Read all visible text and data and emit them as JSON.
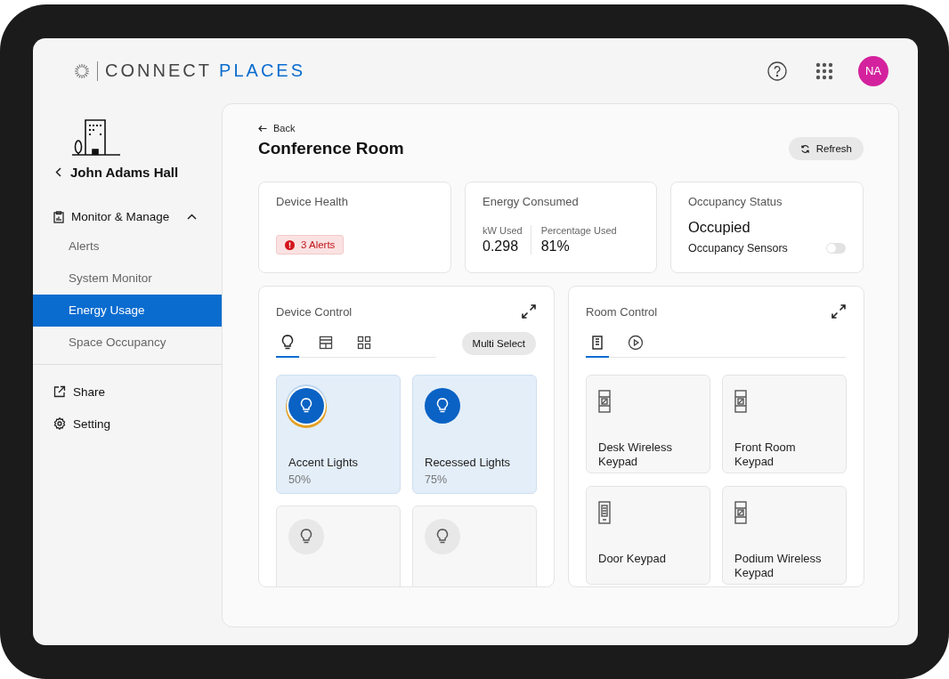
{
  "header": {
    "logo_text": "CONNECT",
    "logo_accent": "PLACES",
    "avatar_initials": "NA"
  },
  "sidebar": {
    "building": "John Adams Hall",
    "section": {
      "label": "Monitor & Manage",
      "expanded": true,
      "items": [
        {
          "label": "Alerts",
          "selected": false
        },
        {
          "label": "System Monitor",
          "selected": false
        },
        {
          "label": "Energy Usage",
          "selected": true
        },
        {
          "label": "Space Occupancy",
          "selected": false
        }
      ]
    },
    "links": [
      {
        "kind": "share",
        "label": "Share"
      },
      {
        "kind": "setting",
        "label": "Setting"
      }
    ]
  },
  "main": {
    "back": "Back",
    "title": "Conference Room",
    "refresh": "Refresh",
    "device_health": {
      "title": "Device Health",
      "alerts": "3 Alerts"
    },
    "energy": {
      "title": "Energy Consumed",
      "metrics": [
        {
          "label": "kW Used",
          "value": "0.298"
        },
        {
          "label": "Percentage Used",
          "value": "81%"
        }
      ]
    },
    "occupancy": {
      "title": "Occupancy Status",
      "status": "Occupied",
      "sensor_label": "Occupancy Sensors",
      "sensors_on": false
    },
    "device_control": {
      "title": "Device Control",
      "multi_select": "Multi Select",
      "tabs": [
        {
          "kind": "bulb",
          "selected": true
        },
        {
          "kind": "shade",
          "selected": false
        },
        {
          "kind": "grid",
          "selected": false
        }
      ],
      "devices": [
        {
          "name": "Accent Lights",
          "reading": "50%",
          "on": true,
          "highlighted": true
        },
        {
          "name": "Recessed Lights",
          "reading": "75%",
          "on": true,
          "highlighted": false
        },
        {
          "on": false,
          "highlighted": false
        },
        {
          "on": false,
          "highlighted": false
        }
      ]
    },
    "room_control": {
      "title": "Room Control",
      "tabs": [
        {
          "kind": "keypad",
          "selected": true
        },
        {
          "kind": "scene",
          "selected": false
        }
      ],
      "keypads": [
        {
          "kind": "wireless",
          "name": "Desk Wireless Keypad"
        },
        {
          "kind": "wireless",
          "name": "Front Room Keypad"
        },
        {
          "kind": "wired",
          "name": "Door Keypad"
        },
        {
          "kind": "wireless",
          "name": "Podium Wireless Keypad"
        }
      ]
    }
  }
}
